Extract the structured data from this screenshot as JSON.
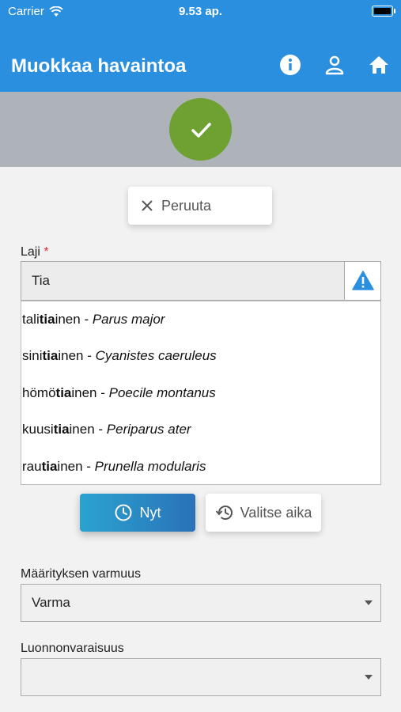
{
  "status_bar": {
    "carrier": "Carrier",
    "time": "9.53 ap."
  },
  "header": {
    "title": "Muokkaa havaintoa",
    "icons": [
      "info-icon",
      "user-icon",
      "home-icon"
    ]
  },
  "actions": {
    "cancel_label": "Peruuta"
  },
  "species": {
    "label": "Laji",
    "required_mark": "*",
    "value": "Tia",
    "suggestions": [
      {
        "pre": "tali",
        "match": "tia",
        "post": "inen",
        "sep": " - ",
        "latin": "Parus major"
      },
      {
        "pre": "sini",
        "match": "tia",
        "post": "inen",
        "sep": " - ",
        "latin": "Cyanistes caeruleus"
      },
      {
        "pre": "hömö",
        "match": "tia",
        "post": "inen",
        "sep": " - ",
        "latin": "Poecile montanus"
      },
      {
        "pre": "kuusi",
        "match": "tia",
        "post": "inen",
        "sep": " - ",
        "latin": "Periparus ater"
      },
      {
        "pre": "rau",
        "match": "tia",
        "post": "inen",
        "sep": " - ",
        "latin": "Prunella modularis"
      }
    ]
  },
  "time": {
    "now_label": "Nyt",
    "choose_label": "Valitse aika"
  },
  "certainty": {
    "label": "Määrityksen varmuus",
    "value": "Varma"
  },
  "wildness": {
    "label": "Luonnonvaraisuus",
    "value": ""
  },
  "colors": {
    "primary": "#2b8fe0",
    "save": "#6fa032",
    "warning": "#2b8fe0"
  }
}
